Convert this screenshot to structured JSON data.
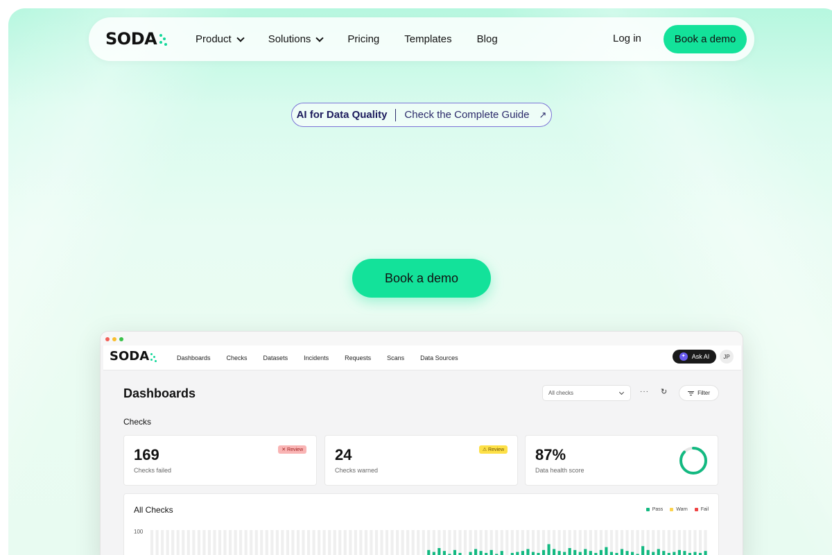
{
  "brand": {
    "name": "SODA",
    "accent": "#13e29a"
  },
  "nav": {
    "items": [
      {
        "label": "Product",
        "dropdown": true
      },
      {
        "label": "Solutions",
        "dropdown": true
      },
      {
        "label": "Pricing",
        "dropdown": false
      },
      {
        "label": "Templates",
        "dropdown": false
      },
      {
        "label": "Blog",
        "dropdown": false
      }
    ],
    "login_label": "Log in",
    "cta_label": "Book a demo"
  },
  "announcement": {
    "tag": "AI for Data Quality",
    "text": "Check the Complete Guide",
    "icon": "arrow-up-right-icon"
  },
  "hero": {
    "cta_label": "Book a demo"
  },
  "app_mockup": {
    "logo": "SODA",
    "tabs": [
      "Dashboards",
      "Checks",
      "Datasets",
      "Incidents",
      "Requests",
      "Scans",
      "Data Sources"
    ],
    "ask_ai_label": "Ask AI",
    "avatar_initials": "JP",
    "page_title": "Dashboards",
    "filter_select": "All checks",
    "more_label": "···",
    "filter_label": "Filter",
    "section_title": "Checks",
    "cards": [
      {
        "value": "169",
        "label": "Checks failed",
        "badge": "✕ Review",
        "badge_color": "#f9b4b4"
      },
      {
        "value": "24",
        "label": "Checks warned",
        "badge": "⚠ Review",
        "badge_color": "#fde047"
      },
      {
        "value": "87%",
        "label": "Data health score",
        "score": 0.87
      }
    ],
    "all_checks": {
      "title": "All Checks",
      "legend": [
        {
          "label": "Pass",
          "color": "#13b981"
        },
        {
          "label": "Warn",
          "color": "#fcd34d"
        },
        {
          "label": "Fail",
          "color": "#ef4444"
        }
      ],
      "y_max_label": "100",
      "pass_heights": [
        0,
        0,
        0,
        0,
        0,
        0,
        0,
        0,
        0,
        0,
        0,
        0,
        0,
        0,
        0,
        0,
        0,
        0,
        0,
        0,
        0,
        0,
        0,
        0,
        0,
        0,
        0,
        0,
        0,
        0,
        0,
        0,
        0,
        0,
        0,
        0,
        0,
        0,
        0,
        0,
        0,
        0,
        0,
        0,
        0,
        0,
        0,
        0,
        0,
        0,
        0,
        0,
        0,
        8,
        6,
        10,
        7,
        4,
        8,
        5,
        0,
        6,
        9,
        7,
        5,
        8,
        4,
        7,
        0,
        5,
        6,
        7,
        9,
        6,
        5,
        8,
        14,
        9,
        7,
        6,
        10,
        8,
        6,
        9,
        7,
        5,
        8,
        11,
        6,
        5,
        9,
        7,
        6,
        4,
        12,
        8,
        6,
        9,
        7,
        5,
        6,
        8,
        7,
        5,
        6,
        5,
        7
      ]
    }
  }
}
